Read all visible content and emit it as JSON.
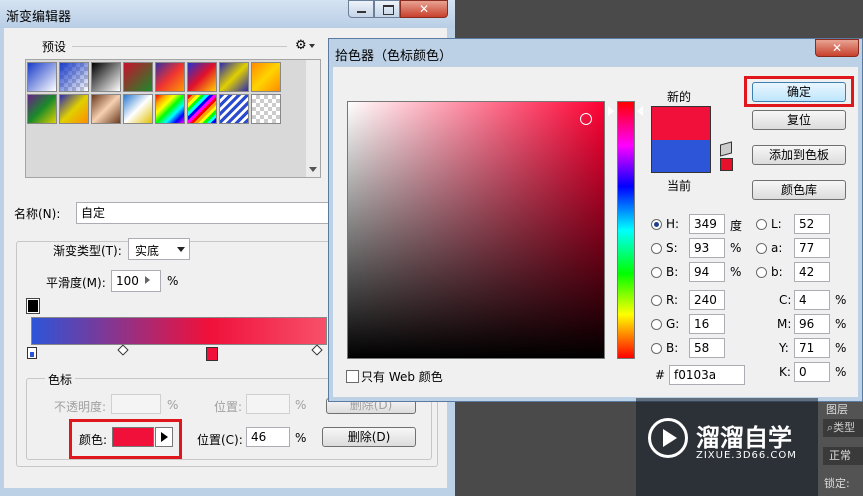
{
  "gradient_editor": {
    "title": "渐变编辑器",
    "presets_label": "预设",
    "name_label": "名称(N):",
    "name_value": "自定",
    "gradient_type_label": "渐变类型(T):",
    "gradient_type_value": "实底",
    "smoothness_label": "平滑度(M):",
    "smoothness_value": "100",
    "percent": "%",
    "stops_label": "色标",
    "opacity_label": "不透明度:",
    "position_label": "位置:",
    "position_label_c": "位置(C):",
    "position_value": "46",
    "delete_label": "删除(D)",
    "color_label": "颜色:",
    "stop_color": "#f0103a"
  },
  "color_picker": {
    "title": "拾色器（色标颜色）",
    "new_label": "新的",
    "current_label": "当前",
    "new_color": "#f0103a",
    "current_color": "#2c55d8",
    "ok_label": "确定",
    "reset_label": "复位",
    "add_swatch_label": "添加到色板",
    "libraries_label": "颜色库",
    "web_only_label": "只有 Web 颜色",
    "hash": "#",
    "hex_value": "f0103a",
    "fields": {
      "H": {
        "label": "H:",
        "value": "349",
        "unit": "度"
      },
      "S": {
        "label": "S:",
        "value": "93",
        "unit": "%"
      },
      "B": {
        "label": "B:",
        "value": "94",
        "unit": "%"
      },
      "R": {
        "label": "R:",
        "value": "240"
      },
      "G": {
        "label": "G:",
        "value": "16"
      },
      "Bl": {
        "label": "B:",
        "value": "58"
      },
      "L": {
        "label": "L:",
        "value": "52"
      },
      "a": {
        "label": "a:",
        "value": "77"
      },
      "b": {
        "label": "b:",
        "value": "42"
      },
      "C": {
        "label": "C:",
        "value": "4",
        "unit": "%"
      },
      "M": {
        "label": "M:",
        "value": "96",
        "unit": "%"
      },
      "Y": {
        "label": "Y:",
        "value": "71",
        "unit": "%"
      },
      "K": {
        "label": "K:",
        "value": "0",
        "unit": "%"
      }
    }
  },
  "background_panel": {
    "layers_label": "图层",
    "kind_label": "类型",
    "normal_label": "正常",
    "lock_label": "锁定:"
  },
  "watermark": {
    "brand": "溜溜自学",
    "url": "ZIXUE.3D66.COM"
  }
}
